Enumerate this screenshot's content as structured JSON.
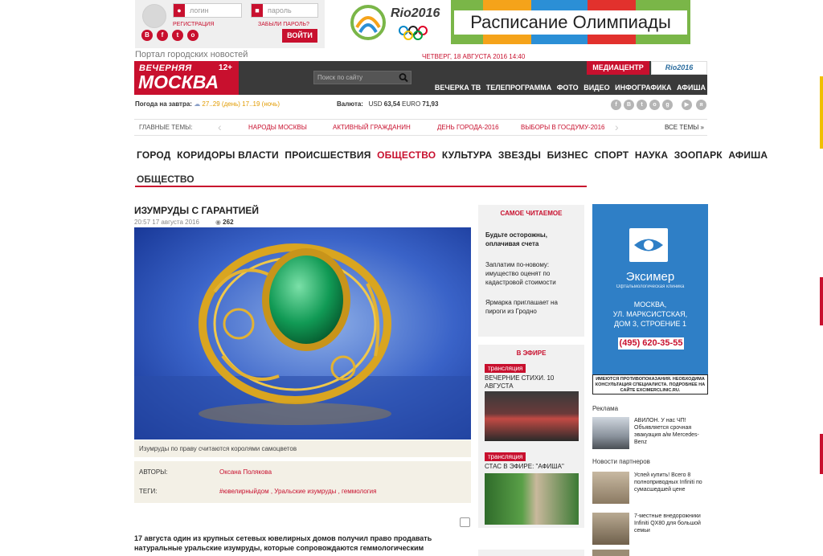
{
  "login": {
    "login_placeholder": "логин",
    "password_placeholder": "пароль",
    "register_label": "РЕГИСТРАЦИЯ",
    "forgot_label": "ЗАБЫЛИ ПАРОЛЬ?",
    "submit_label": "ВОЙТИ",
    "social": [
      "В",
      "f",
      "t",
      "о"
    ]
  },
  "banners": {
    "rio_text": "Rio2016",
    "schedule_text": "Расписание Олимпиады"
  },
  "portal_label": "Портал городских новостей",
  "date_label": "ЧЕТВЕРГ, 18 АВГУСТА 2016 14:40",
  "header": {
    "logo_line1": "ВЕЧЕРНЯЯ",
    "logo_line2": "МОСКВА",
    "age": "12+",
    "search_placeholder": "Поиск по сайту",
    "mediacenter": "МЕДИАЦЕНТР",
    "rio_small": "Rio2016",
    "nav": [
      "Вечерка ТВ",
      "Телепрограмма",
      "Фото",
      "Видео",
      "Инфографика",
      "Афиша"
    ]
  },
  "weather": {
    "label": "Погода на завтра:",
    "day_temp": "27..29",
    "day_label": "(день)",
    "night_temp": "17..19",
    "night_label": "(ночь)"
  },
  "currency": {
    "label": "Валюта:",
    "usd_label": "USD",
    "usd_value": "63,54",
    "euro_label": "EURO",
    "euro_value": "71,93"
  },
  "social_icons": [
    "f",
    "В",
    "t",
    "о",
    "g",
    "▶",
    "я"
  ],
  "topics": {
    "label": "ГЛАВНЫЕ ТЕМЫ:",
    "items": [
      "НАРОДЫ МОСКВЫ",
      "АКТИВНЫЙ ГРАЖДАНИН",
      "ДЕНЬ ГОРОДА-2016",
      "ВЫБОРЫ В ГОСДУМУ-2016"
    ],
    "all_label": "ВСЕ ТЕМЫ »"
  },
  "categories": [
    "Город",
    "Коридоры власти",
    "Происшествия",
    "Общество",
    "Культура",
    "Звезды",
    "Бизнес",
    "Спорт",
    "Наука",
    "Зоопарк",
    "Афиша"
  ],
  "active_category": "Общество",
  "section_title": "ОБЩЕСТВО",
  "article": {
    "title": "ИЗУМРУДЫ С ГАРАНТИЕЙ",
    "datetime": "20:57 17 августа 2016",
    "views": "262",
    "caption": "Изумруды по праву считаются королями самоцветов",
    "authors_label": "АВТОРЫ:",
    "author": "Оксана Полякова",
    "tags_label": "ТЕГИ:",
    "tags": "#ювелирныйдом , Уральские изумруды , геммология",
    "lead": "17 августа один из крупных сетевых ювелирных домов получил право продавать натуральные уральские изумруды, которые сопровождаются геммологическим"
  },
  "popular": {
    "title": "САМОЕ ЧИТАЕМОЕ",
    "items": [
      "Будьте осторожны, оплачивая счета",
      "Заплатим по-новому: имущество оценят по кадастровой стоимости",
      "Ярмарка приглашает на пироги из Гродно"
    ]
  },
  "live": {
    "title": "В ЭФИРЕ",
    "tag": "трансляция",
    "items": [
      "ВЕЧЕРНИЕ СТИХИ. 10 АВГУСТА",
      "СТАС В ЭФИРЕ: \"АФИША\""
    ]
  },
  "ad": {
    "brand": "Эксимер",
    "subtitle": "Офтальмологическая клиника",
    "address": [
      "МОСКВА,",
      "УЛ. МАРКСИСТСКАЯ,",
      "ДОМ 3, СТРОЕНИЕ 1"
    ],
    "phone": "(495) 620-35-55",
    "warning": "ИМЕЮТСЯ ПРОТИВОПОКАЗАНИЯ. НЕОБХОДИМА КОНСУЛЬТАЦИЯ СПЕЦИАЛИСТА. ПОДРОБНЕЕ НА САЙТЕ EXCIMERCLINIC.RU."
  },
  "sidebar": {
    "ads_label": "Реклама",
    "ad_text": "АВИЛОН. У нас ЧП! Объявляется срочная эвакуация а/м Mercedes-Benz",
    "partners_label": "Новости партнеров",
    "partner_items": [
      "Успей купить! Всего 8 полноприводных Infiniti по сумасшедшей цене",
      "7-местные внедорожники Infiniti QX80 для большой семьи"
    ]
  },
  "colors": {
    "accent": "#c8102e",
    "header_bg": "#3a3a3a",
    "ad_bg": "#2f7fc6"
  }
}
